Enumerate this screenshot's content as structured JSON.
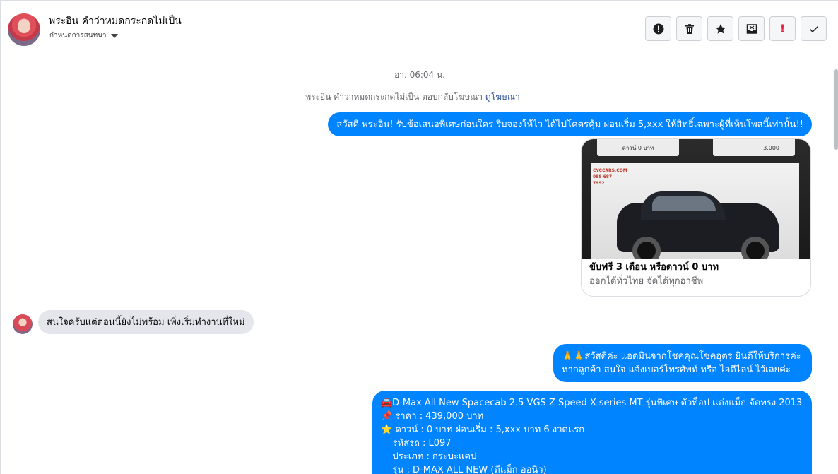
{
  "header": {
    "contact_name": "พระอิน คําว่าหมดกระกดไม่เป็น",
    "subtitle": "กําหนดการสนทนา",
    "toolbar": [
      {
        "name": "spam-button",
        "icon": "exclamation-circle-icon"
      },
      {
        "name": "delete-button",
        "icon": "trash-icon"
      },
      {
        "name": "star-button",
        "icon": "star-icon"
      },
      {
        "name": "archive-button",
        "icon": "archive-box-icon"
      },
      {
        "name": "mark-important-button",
        "icon": "exclamation-icon",
        "label": "!"
      },
      {
        "name": "mark-done-button",
        "icon": "checkmark-icon"
      }
    ]
  },
  "conversation": {
    "timestamp": "อา. 06:04 น.",
    "reply_note": "พระอิน คําว่าหมดกระกดไม่เป็น ตอบกลับโฆษณา",
    "reply_link": "ดูโฆษณา",
    "messages": [
      {
        "direction": "out",
        "text": "สวัสดี พระอิน! รับข้อเสนอพิเศษก่อนใคร รีบจองให้ไว ได้ไปโคตรคุ้ม ผ่อนเริ่ม 5,xxx  ให้สิทธิ์เฉพาะผู้ที่เห็นโพสนี้เท่านั้น!!"
      },
      {
        "direction": "out",
        "type": "ad-card",
        "title": "ขับฟรี 3 เดือน หรือดาวน์ 0 บาท",
        "subtitle": "ออกได้ทั่วไทย จัดได้ทุกอาชีพ",
        "image_strip_left": "ดาวน์ 0 บาท",
        "image_strip_right": "3,000",
        "image_logo": "CYCCARS.COM 088 687 7992"
      },
      {
        "direction": "in",
        "text": "สนใจครับแต่ตอนนี้ยังไม่พร้อม เพิ่งเริ่มทำงานที่ใหม่"
      },
      {
        "direction": "out",
        "lines": [
          "🙏🙏สวัสดีค่ะ แอดมินจากโชคคุณโชคอุตร ยินดีให้บริการค่ะ",
          "หากลูกค้า สนใจ แจ้งเบอร์โทรศัพท์ หรือ ไอดีไลน์  ไว้เลยค่ะ"
        ]
      },
      {
        "direction": "out",
        "lines": [
          "🚘D-Max All New Spacecab 2.5 VGS Z Speed X-series MT รุ่นพิเศษ ตัวท็อป แต่งแม็ก จัดทรง 2013",
          "📌 ราคา : 439,000 บาท",
          "⭐ ดาวน์ : 0 บาท ผ่อนเริ่ม : 5,xxx บาท 6 งวดแรก",
          "    รหัสรถ : L097",
          "    ประเภท : กระบะแคป",
          "    รุ่น : D-MAX ALL NEW (ดีแม็ก ออนิว)"
        ]
      }
    ]
  }
}
